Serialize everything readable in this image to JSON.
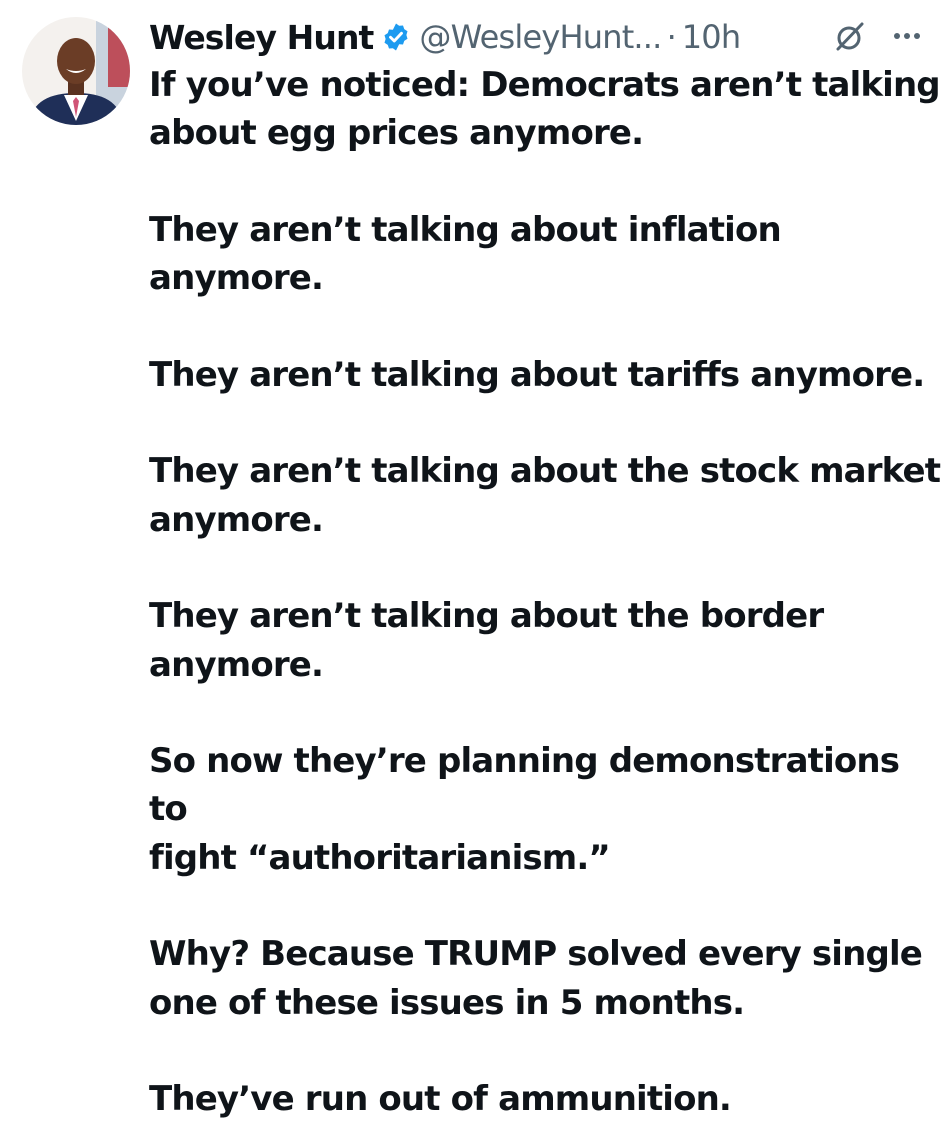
{
  "tweet": {
    "author": {
      "name": "Wesley Hunt",
      "handle": "@WesleyHunt...",
      "verified": true,
      "avatar_icon": "profile-photo"
    },
    "separator": "·",
    "time": "10h",
    "grok_icon": "grok-icon",
    "more_icon": "more-horizontal-icon",
    "paragraphs": [
      "If you’ve noticed: Democrats aren’t talking\nabout egg prices anymore.",
      "They aren’t talking about inflation\nanymore.",
      "They aren’t talking about tariffs anymore.",
      "They aren’t talking about the stock market\nanymore.",
      "They aren’t talking about the border\nanymore.",
      "So now they’re planning demonstrations to\nfight “authoritarianism.”",
      "Why?  Because TRUMP solved every single\none of these issues in 5 months.",
      "They’ve run out of ammunition."
    ]
  },
  "colors": {
    "text": "#0f1419",
    "secondary": "#536471",
    "verified_blue": "#1d9bf0"
  }
}
